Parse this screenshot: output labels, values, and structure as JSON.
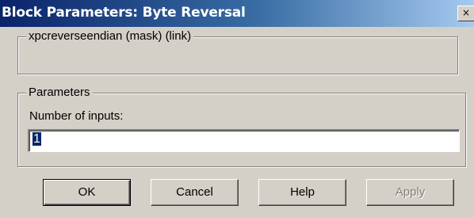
{
  "window": {
    "title": "Block Parameters: Byte Reversal",
    "close_label": "×"
  },
  "description_group": {
    "legend": "xpcreverseendian (mask) (link)"
  },
  "parameters_group": {
    "legend": "Parameters",
    "field_label": "Number of inputs:",
    "field_value": "1"
  },
  "buttons": {
    "ok": "OK",
    "cancel": "Cancel",
    "help": "Help",
    "apply": "Apply"
  }
}
